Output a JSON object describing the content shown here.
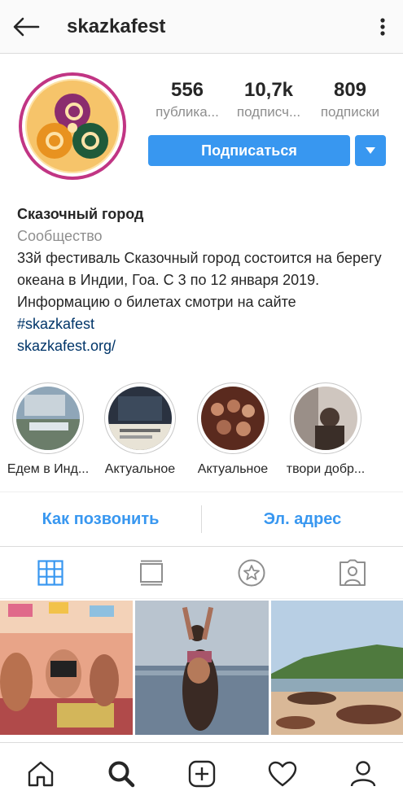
{
  "header": {
    "username": "skazkafest",
    "back_icon": "arrow-left-icon",
    "more_icon": "more-vertical-icon"
  },
  "stats": {
    "posts": {
      "value": "556",
      "label": "публика..."
    },
    "followers": {
      "value": "10,7k",
      "label": "подписч..."
    },
    "following": {
      "value": "809",
      "label": "подписки"
    }
  },
  "follow_button": "Подписаться",
  "bio": {
    "name": "Сказочный город",
    "category": "Сообщество",
    "text": "33й фестиваль Сказочный город состоится на берегу океана в Индии, Гоа. С 3 по 12 января 2019. Информацию о билетах смотри на сайте",
    "hashtag": "#skazkafest",
    "link": "skazkafest.org/"
  },
  "highlights": [
    {
      "label": "Едем в Инд..."
    },
    {
      "label": "Актуальное"
    },
    {
      "label": "Актуальное"
    },
    {
      "label": "твори добр..."
    }
  ],
  "actions": {
    "call": "Как позвонить",
    "email": "Эл. адрес"
  },
  "tabs": [
    "grid-icon",
    "feed-icon",
    "igtv-star-icon",
    "tagged-icon"
  ],
  "bottom_nav": [
    "home-icon",
    "search-icon",
    "add-post-icon",
    "activity-heart-icon",
    "profile-icon"
  ],
  "colors": {
    "accent": "#3897f0",
    "link": "#003569",
    "secondary_text": "#8e8e8e",
    "avatar_ring": "#c13584"
  }
}
